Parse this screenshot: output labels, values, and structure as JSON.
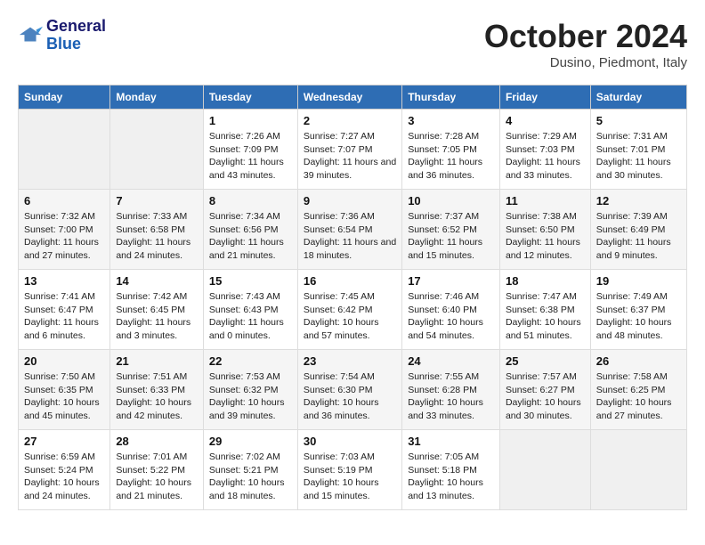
{
  "header": {
    "logo_line1": "General",
    "logo_line2": "Blue",
    "title": "October 2024",
    "subtitle": "Dusino, Piedmont, Italy"
  },
  "days_of_week": [
    "Sunday",
    "Monday",
    "Tuesday",
    "Wednesday",
    "Thursday",
    "Friday",
    "Saturday"
  ],
  "weeks": [
    [
      {
        "day": "",
        "empty": true
      },
      {
        "day": "",
        "empty": true
      },
      {
        "day": "1",
        "sunrise": "Sunrise: 7:26 AM",
        "sunset": "Sunset: 7:09 PM",
        "daylight": "Daylight: 11 hours and 43 minutes."
      },
      {
        "day": "2",
        "sunrise": "Sunrise: 7:27 AM",
        "sunset": "Sunset: 7:07 PM",
        "daylight": "Daylight: 11 hours and 39 minutes."
      },
      {
        "day": "3",
        "sunrise": "Sunrise: 7:28 AM",
        "sunset": "Sunset: 7:05 PM",
        "daylight": "Daylight: 11 hours and 36 minutes."
      },
      {
        "day": "4",
        "sunrise": "Sunrise: 7:29 AM",
        "sunset": "Sunset: 7:03 PM",
        "daylight": "Daylight: 11 hours and 33 minutes."
      },
      {
        "day": "5",
        "sunrise": "Sunrise: 7:31 AM",
        "sunset": "Sunset: 7:01 PM",
        "daylight": "Daylight: 11 hours and 30 minutes."
      }
    ],
    [
      {
        "day": "6",
        "sunrise": "Sunrise: 7:32 AM",
        "sunset": "Sunset: 7:00 PM",
        "daylight": "Daylight: 11 hours and 27 minutes."
      },
      {
        "day": "7",
        "sunrise": "Sunrise: 7:33 AM",
        "sunset": "Sunset: 6:58 PM",
        "daylight": "Daylight: 11 hours and 24 minutes."
      },
      {
        "day": "8",
        "sunrise": "Sunrise: 7:34 AM",
        "sunset": "Sunset: 6:56 PM",
        "daylight": "Daylight: 11 hours and 21 minutes."
      },
      {
        "day": "9",
        "sunrise": "Sunrise: 7:36 AM",
        "sunset": "Sunset: 6:54 PM",
        "daylight": "Daylight: 11 hours and 18 minutes."
      },
      {
        "day": "10",
        "sunrise": "Sunrise: 7:37 AM",
        "sunset": "Sunset: 6:52 PM",
        "daylight": "Daylight: 11 hours and 15 minutes."
      },
      {
        "day": "11",
        "sunrise": "Sunrise: 7:38 AM",
        "sunset": "Sunset: 6:50 PM",
        "daylight": "Daylight: 11 hours and 12 minutes."
      },
      {
        "day": "12",
        "sunrise": "Sunrise: 7:39 AM",
        "sunset": "Sunset: 6:49 PM",
        "daylight": "Daylight: 11 hours and 9 minutes."
      }
    ],
    [
      {
        "day": "13",
        "sunrise": "Sunrise: 7:41 AM",
        "sunset": "Sunset: 6:47 PM",
        "daylight": "Daylight: 11 hours and 6 minutes."
      },
      {
        "day": "14",
        "sunrise": "Sunrise: 7:42 AM",
        "sunset": "Sunset: 6:45 PM",
        "daylight": "Daylight: 11 hours and 3 minutes."
      },
      {
        "day": "15",
        "sunrise": "Sunrise: 7:43 AM",
        "sunset": "Sunset: 6:43 PM",
        "daylight": "Daylight: 11 hours and 0 minutes."
      },
      {
        "day": "16",
        "sunrise": "Sunrise: 7:45 AM",
        "sunset": "Sunset: 6:42 PM",
        "daylight": "Daylight: 10 hours and 57 minutes."
      },
      {
        "day": "17",
        "sunrise": "Sunrise: 7:46 AM",
        "sunset": "Sunset: 6:40 PM",
        "daylight": "Daylight: 10 hours and 54 minutes."
      },
      {
        "day": "18",
        "sunrise": "Sunrise: 7:47 AM",
        "sunset": "Sunset: 6:38 PM",
        "daylight": "Daylight: 10 hours and 51 minutes."
      },
      {
        "day": "19",
        "sunrise": "Sunrise: 7:49 AM",
        "sunset": "Sunset: 6:37 PM",
        "daylight": "Daylight: 10 hours and 48 minutes."
      }
    ],
    [
      {
        "day": "20",
        "sunrise": "Sunrise: 7:50 AM",
        "sunset": "Sunset: 6:35 PM",
        "daylight": "Daylight: 10 hours and 45 minutes."
      },
      {
        "day": "21",
        "sunrise": "Sunrise: 7:51 AM",
        "sunset": "Sunset: 6:33 PM",
        "daylight": "Daylight: 10 hours and 42 minutes."
      },
      {
        "day": "22",
        "sunrise": "Sunrise: 7:53 AM",
        "sunset": "Sunset: 6:32 PM",
        "daylight": "Daylight: 10 hours and 39 minutes."
      },
      {
        "day": "23",
        "sunrise": "Sunrise: 7:54 AM",
        "sunset": "Sunset: 6:30 PM",
        "daylight": "Daylight: 10 hours and 36 minutes."
      },
      {
        "day": "24",
        "sunrise": "Sunrise: 7:55 AM",
        "sunset": "Sunset: 6:28 PM",
        "daylight": "Daylight: 10 hours and 33 minutes."
      },
      {
        "day": "25",
        "sunrise": "Sunrise: 7:57 AM",
        "sunset": "Sunset: 6:27 PM",
        "daylight": "Daylight: 10 hours and 30 minutes."
      },
      {
        "day": "26",
        "sunrise": "Sunrise: 7:58 AM",
        "sunset": "Sunset: 6:25 PM",
        "daylight": "Daylight: 10 hours and 27 minutes."
      }
    ],
    [
      {
        "day": "27",
        "sunrise": "Sunrise: 6:59 AM",
        "sunset": "Sunset: 5:24 PM",
        "daylight": "Daylight: 10 hours and 24 minutes."
      },
      {
        "day": "28",
        "sunrise": "Sunrise: 7:01 AM",
        "sunset": "Sunset: 5:22 PM",
        "daylight": "Daylight: 10 hours and 21 minutes."
      },
      {
        "day": "29",
        "sunrise": "Sunrise: 7:02 AM",
        "sunset": "Sunset: 5:21 PM",
        "daylight": "Daylight: 10 hours and 18 minutes."
      },
      {
        "day": "30",
        "sunrise": "Sunrise: 7:03 AM",
        "sunset": "Sunset: 5:19 PM",
        "daylight": "Daylight: 10 hours and 15 minutes."
      },
      {
        "day": "31",
        "sunrise": "Sunrise: 7:05 AM",
        "sunset": "Sunset: 5:18 PM",
        "daylight": "Daylight: 10 hours and 13 minutes."
      },
      {
        "day": "",
        "empty": true
      },
      {
        "day": "",
        "empty": true
      }
    ]
  ]
}
